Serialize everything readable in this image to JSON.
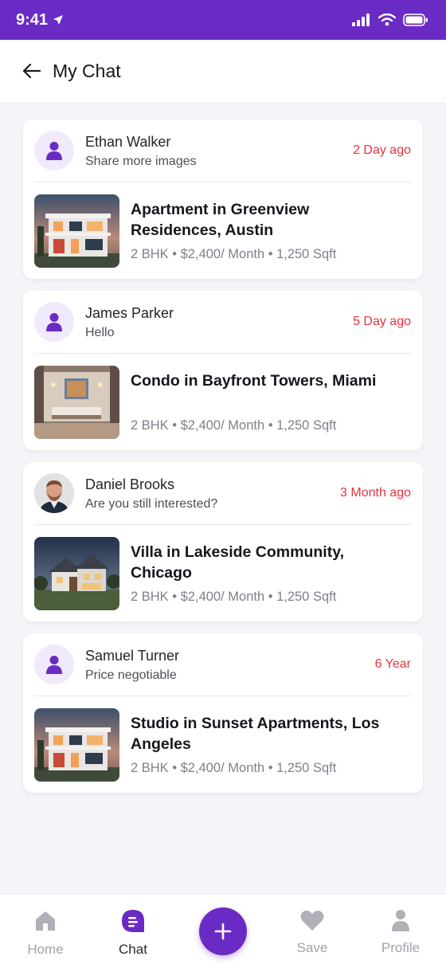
{
  "status_bar": {
    "time": "9:41"
  },
  "header": {
    "title": "My Chat"
  },
  "chats": [
    {
      "name": "Ethan Walker",
      "message": "Share more images",
      "time": "2 Day ago",
      "avatar": "user-icon",
      "property_title": "Apartment in Greenview Residences, Austin",
      "property_meta": "2 BHK • $2,400/ Month • 1,250 Sqft",
      "thumb": "modern-house"
    },
    {
      "name": "James Parker",
      "message": "Hello",
      "time": "5 Day ago",
      "avatar": "user-icon",
      "property_title": "Condo in Bayfront Towers, Miami",
      "property_meta": "2 BHK • $2,400/ Month • 1,250 Sqft",
      "thumb": "interior-room"
    },
    {
      "name": "Daniel Brooks",
      "message": "Are you still interested?",
      "time": "3 Month ago",
      "avatar": "photo",
      "property_title": "Villa in Lakeside Community, Chicago",
      "property_meta": "2 BHK • $2,400/ Month • 1,250 Sqft",
      "thumb": "villa"
    },
    {
      "name": "Samuel Turner",
      "message": "Price negotiable",
      "time": "6 Year",
      "avatar": "user-icon",
      "property_title": "Studio in Sunset Apartments, Los Angeles",
      "property_meta": "2 BHK • $2,400/ Month • 1,250 Sqft",
      "thumb": "modern-house"
    }
  ],
  "bottom_nav": {
    "home": "Home",
    "chat": "Chat",
    "save": "Save",
    "profile": "Profile"
  },
  "colors": {
    "brand": "#6a2bc4",
    "time_red": "#e8323f",
    "avatar_bg": "#f1eafc"
  }
}
